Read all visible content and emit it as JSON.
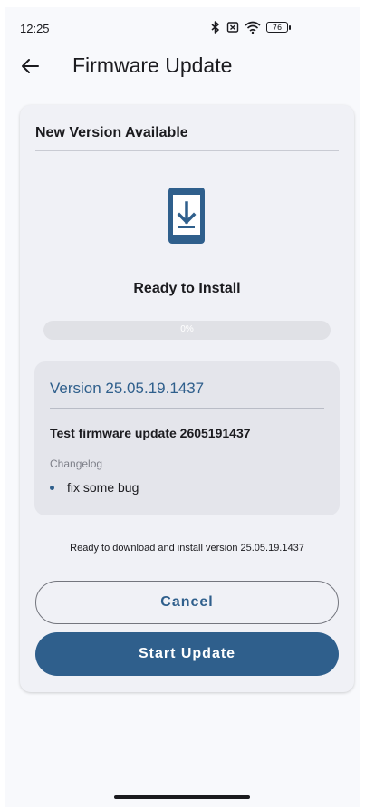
{
  "status_bar": {
    "time": "12:25",
    "bluetooth_icon": "bluetooth-icon",
    "sim_icon": "sim-blocked-icon",
    "wifi_icon": "wifi-icon",
    "battery": "76"
  },
  "app_bar": {
    "title": "Firmware Update",
    "back_icon": "arrow-left-icon"
  },
  "card": {
    "title": "New Version Available",
    "icon": "phone-download-icon",
    "status_title": "Ready to Install",
    "progress": {
      "percent": 0,
      "label": "0%"
    },
    "version_box": {
      "title": "Version 25.05.19.1437",
      "description": "Test firmware update 2605191437",
      "changelog_label": "Changelog",
      "changelog_items": [
        "fix some bug"
      ]
    },
    "info_text": "Ready to download and install version 25.05.19.1437",
    "cancel_label": "Cancel",
    "start_label": "Start Update"
  },
  "colors": {
    "primary": "#2f5f8c",
    "background": "#f8f9fc",
    "card": "#f0f1f6",
    "version_box": "#e4e5eb"
  }
}
